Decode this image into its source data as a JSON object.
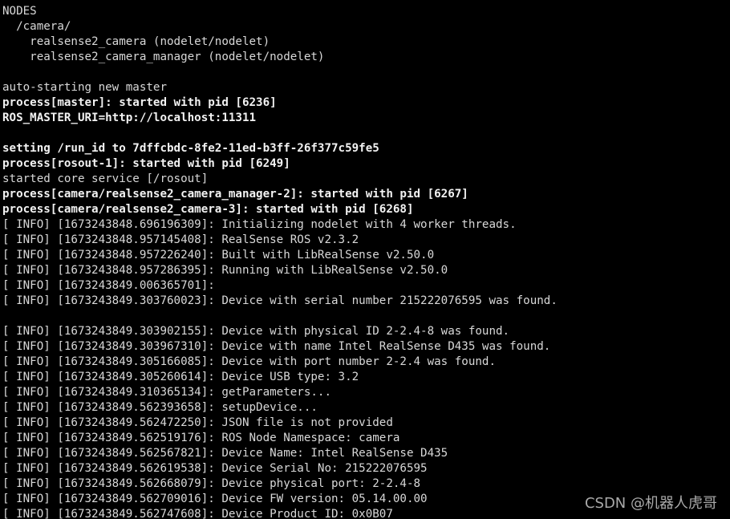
{
  "terminal": {
    "lines": [
      {
        "text": "NODES",
        "bold": false
      },
      {
        "text": "  /camera/",
        "bold": false
      },
      {
        "text": "    realsense2_camera (nodelet/nodelet)",
        "bold": false
      },
      {
        "text": "    realsense2_camera_manager (nodelet/nodelet)",
        "bold": false
      },
      {
        "text": "",
        "bold": false
      },
      {
        "text": "auto-starting new master",
        "bold": false
      },
      {
        "text": "process[master]: started with pid [6236]",
        "bold": true
      },
      {
        "text": "ROS_MASTER_URI=http://localhost:11311",
        "bold": true
      },
      {
        "text": "",
        "bold": false
      },
      {
        "text": "setting /run_id to 7dffcbdc-8fe2-11ed-b3ff-26f377c59fe5",
        "bold": true
      },
      {
        "text": "process[rosout-1]: started with pid [6249]",
        "bold": true
      },
      {
        "text": "started core service [/rosout]",
        "bold": false
      },
      {
        "text": "process[camera/realsense2_camera_manager-2]: started with pid [6267]",
        "bold": true
      },
      {
        "text": "process[camera/realsense2_camera-3]: started with pid [6268]",
        "bold": true
      },
      {
        "text": "[ INFO] [1673243848.696196309]: Initializing nodelet with 4 worker threads.",
        "bold": false
      },
      {
        "text": "[ INFO] [1673243848.957145408]: RealSense ROS v2.3.2",
        "bold": false
      },
      {
        "text": "[ INFO] [1673243848.957226240]: Built with LibRealSense v2.50.0",
        "bold": false
      },
      {
        "text": "[ INFO] [1673243848.957286395]: Running with LibRealSense v2.50.0",
        "bold": false
      },
      {
        "text": "[ INFO] [1673243849.006365701]:",
        "bold": false
      },
      {
        "text": "[ INFO] [1673243849.303760023]: Device with serial number 215222076595 was found.",
        "bold": false
      },
      {
        "text": "",
        "bold": false
      },
      {
        "text": "[ INFO] [1673243849.303902155]: Device with physical ID 2-2.4-8 was found.",
        "bold": false
      },
      {
        "text": "[ INFO] [1673243849.303967310]: Device with name Intel RealSense D435 was found.",
        "bold": false
      },
      {
        "text": "[ INFO] [1673243849.305166085]: Device with port number 2-2.4 was found.",
        "bold": false
      },
      {
        "text": "[ INFO] [1673243849.305260614]: Device USB type: 3.2",
        "bold": false
      },
      {
        "text": "[ INFO] [1673243849.310365134]: getParameters...",
        "bold": false
      },
      {
        "text": "[ INFO] [1673243849.562393658]: setupDevice...",
        "bold": false
      },
      {
        "text": "[ INFO] [1673243849.562472250]: JSON file is not provided",
        "bold": false
      },
      {
        "text": "[ INFO] [1673243849.562519176]: ROS Node Namespace: camera",
        "bold": false
      },
      {
        "text": "[ INFO] [1673243849.562567821]: Device Name: Intel RealSense D435",
        "bold": false
      },
      {
        "text": "[ INFO] [1673243849.562619538]: Device Serial No: 215222076595",
        "bold": false
      },
      {
        "text": "[ INFO] [1673243849.562668079]: Device physical port: 2-2.4-8",
        "bold": false
      },
      {
        "text": "[ INFO] [1673243849.562709016]: Device FW version: 05.14.00.00",
        "bold": false
      },
      {
        "text": "[ INFO] [1673243849.562747608]: Device Product ID: 0x0B07",
        "bold": false
      }
    ]
  },
  "watermark": "CSDN @机器人虎哥",
  "colors": {
    "background": "#000000",
    "text": "#d8d8d8",
    "bold_text": "#f2f2f2"
  }
}
